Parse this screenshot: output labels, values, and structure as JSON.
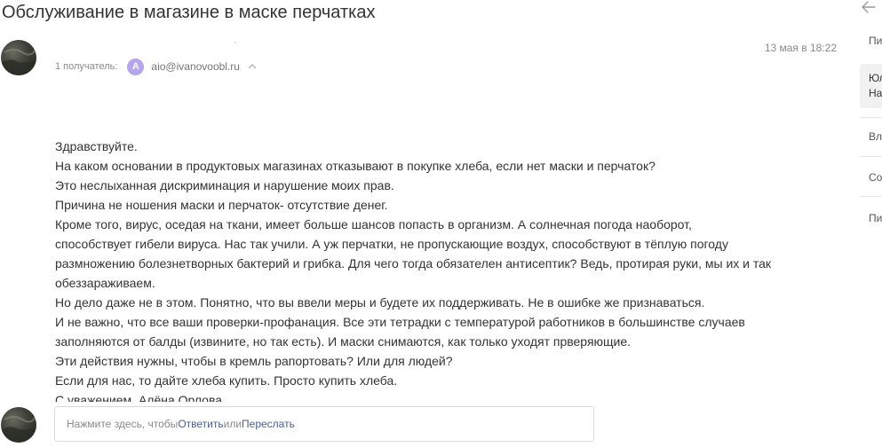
{
  "email": {
    "subject": "Обслуживание в магазине в маске перчатках",
    "recipients_label": "1 получатель:",
    "recipient_initial": "A",
    "recipient_email": "aio@ivanovoobl.ru",
    "date": "13 мая в 18:22",
    "body_lines": [
      "Здравствуйте.",
      "На каком основании в продуктовых магазинах отказывают в покупке хлеба, если нет маски и перчаток?",
      "Это неслыханная дискриминация и нарушение моих прав.",
      "Причина не ношения маски и перчаток- отсутствие денег.",
      "Кроме того, вирус, оседая на ткани, имеет больше шансов попасть в организм. А солнечная погода наоборот,",
      "способствует гибели вируса. Нас так учили. А уж перчатки, не пропускающие воздух, способствуют в тёплую погоду",
      "размножению болезнетворных бактерий и грибка. Для чего тогда обязателен антисептик? Ведь, протирая руки, мы их и так",
      "обеззараживаем.",
      "Но дело даже не в этом. Понятно, что вы ввели меры и будете их поддерживать. Не в ошибке же признаваться.",
      "И не важно, что все ваши проверки-профанация. Все эти тетрадки с температурой работников в большинстве случаев",
      "заполняются от балды (извините, но так есть). И маски снимаются, как только уходят прверяющие.",
      "Эти действия нужны, чтобы в кремль рапортовать? Или для людей?",
      "Если для нас, то дайте хлеба купить. Просто купить хлеба.",
      "С уважением, Алёна Орлова"
    ]
  },
  "reply": {
    "prompt": "Нажмите здесь, чтобы ",
    "reply_link": "Ответить",
    "or": " или ",
    "forward_link": "Переслать"
  },
  "right_panel": {
    "item_1": "Пи",
    "selected_line_1": "Юл",
    "selected_line_2": "На",
    "item_2": "Вл",
    "item_3": "Со",
    "item_4": "Пи"
  },
  "colors": {
    "recipient_avatar": "#b3a6ec",
    "link": "#4c5e8f"
  }
}
